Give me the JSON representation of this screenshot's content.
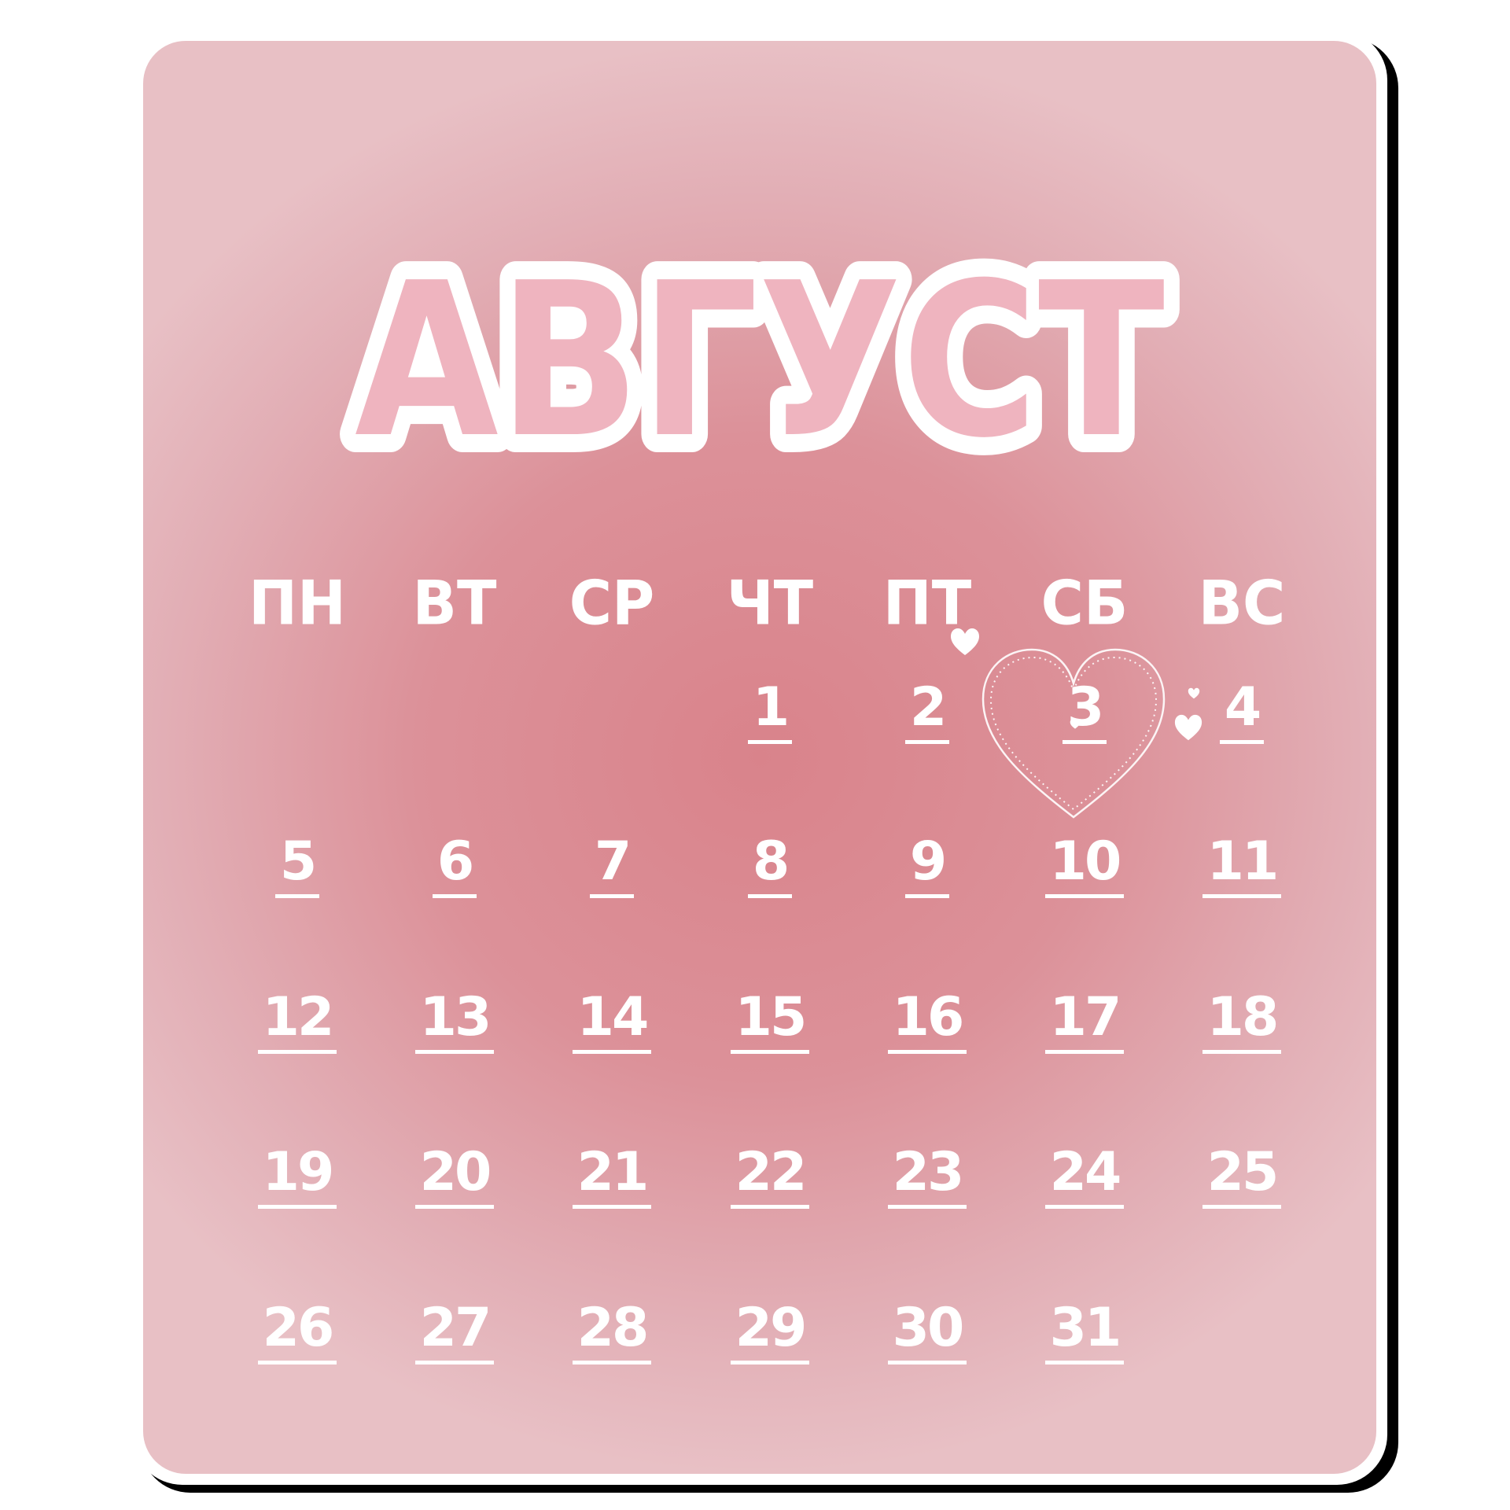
{
  "calendar": {
    "month": "АВГУСТ",
    "weekdays": [
      "ПН",
      "ВТ",
      "СР",
      "ЧТ",
      "ПТ",
      "СБ",
      "ВС"
    ],
    "start_weekday_index": 3,
    "days_in_month": 31,
    "highlighted_day": "3",
    "days": [
      "1",
      "2",
      "3",
      "4",
      "5",
      "6",
      "7",
      "8",
      "9",
      "10",
      "11",
      "12",
      "13",
      "14",
      "15",
      "16",
      "17",
      "18",
      "19",
      "20",
      "21",
      "22",
      "23",
      "24",
      "25",
      "26",
      "27",
      "28",
      "29",
      "30",
      "31"
    ]
  },
  "colors": {
    "card_background": "#dc8f97",
    "title_fill": "#efb4bf",
    "title_outline": "#ffffff",
    "text": "#ffffff",
    "border": "#ffffff",
    "shadow": "#000000"
  },
  "icons": [
    "heart-frame-icon",
    "small-heart-icon"
  ]
}
